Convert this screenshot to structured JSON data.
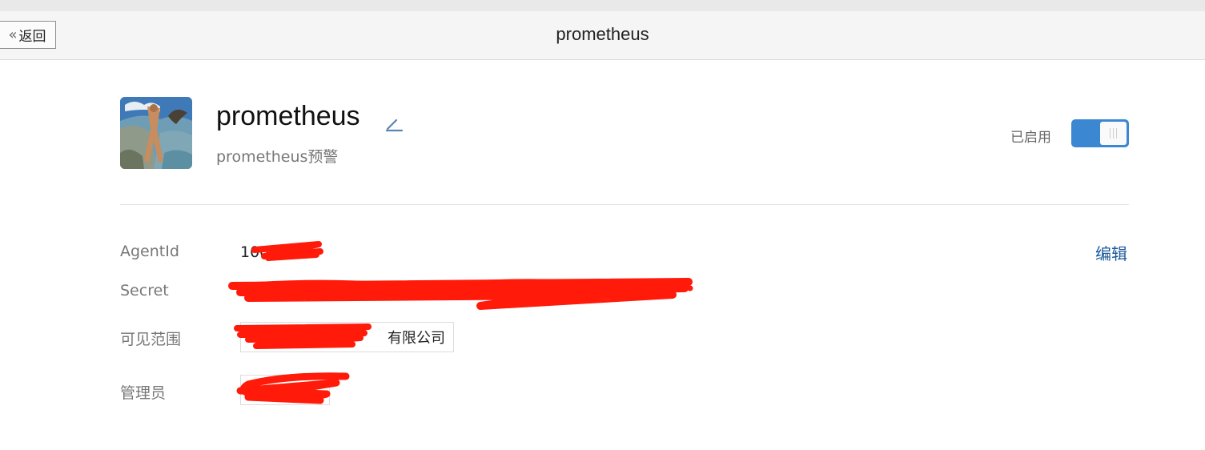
{
  "navbar": {
    "back_label": "返回",
    "title": "prometheus"
  },
  "app": {
    "name": "prometheus",
    "description": "prometheus预警",
    "status_label": "已启用",
    "enabled": true
  },
  "details": {
    "edit_label": "编辑",
    "agentid": {
      "label": "AgentId",
      "value": "100"
    },
    "secret": {
      "label": "Secret",
      "value": ""
    },
    "scope": {
      "label": "可见范围",
      "value": "有限公司"
    },
    "admin": {
      "label": "管理员",
      "value": ""
    }
  },
  "colors": {
    "toggle_on": "#3b87d2",
    "link": "#1a5a9a",
    "redaction": "#ff1a0a"
  },
  "icons": {
    "back": "chevron-double-left-icon",
    "edit": "pencil-icon"
  }
}
